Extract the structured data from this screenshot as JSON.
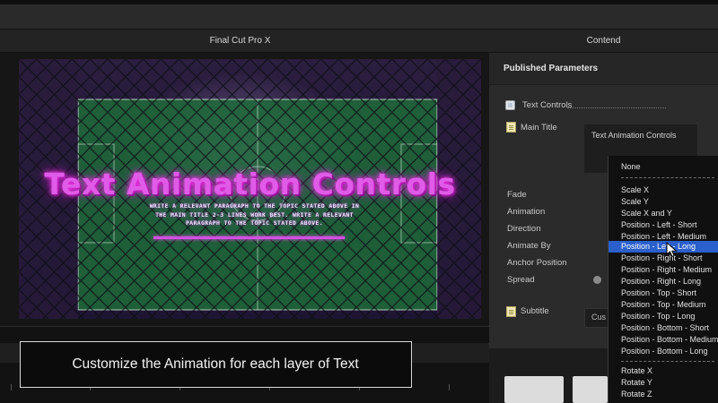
{
  "window": {
    "app_title": "Final Cut Pro X",
    "inspector_title": "Contend"
  },
  "viewer": {
    "overlay_title": "Text Animation Controls",
    "overlay_paragraph": "WRITE A RELEVANT PARAGRAPH TO THE TOPIC STATED ABOVE IN THE MAIN TITLE 2-3 LINES WORK BEST. WRITE A RELEVANT PARAGRAPH TO THE TOPIC STATED ABOVE."
  },
  "inspector": {
    "header": "Published Parameters",
    "text_controls_label": "Text Controls",
    "main_title_label": "Main Title",
    "popup_label": "Text Animation Controls",
    "params": [
      "Fade",
      "Animation",
      "Direction",
      "Animate By",
      "Anchor Position",
      "Spread"
    ],
    "subtitle_label": "Subtitle",
    "custom_chip": "Cus"
  },
  "dropdown": {
    "selected": "Position - Left - Long",
    "items": [
      "None",
      "Scale X",
      "Scale Y",
      "Scale X and Y",
      "Position - Left - Short",
      "Position - Left - Medium",
      "Position - Left - Long",
      "Position - Right - Short",
      "Position - Right - Medium",
      "Position - Right - Long",
      "Position - Top - Short",
      "Position - Top - Medium",
      "Position - Top - Long",
      "Position - Bottom - Short",
      "Position - Bottom - Medium",
      "Position - Bottom - Long",
      "Rotate X",
      "Rotate Y",
      "Rotate Z"
    ]
  },
  "caption": "Customize the Animation for each layer of Text",
  "colors": {
    "selection": "#2a5fcc",
    "neon": "#e05be8",
    "field": "#1f6b3a"
  }
}
